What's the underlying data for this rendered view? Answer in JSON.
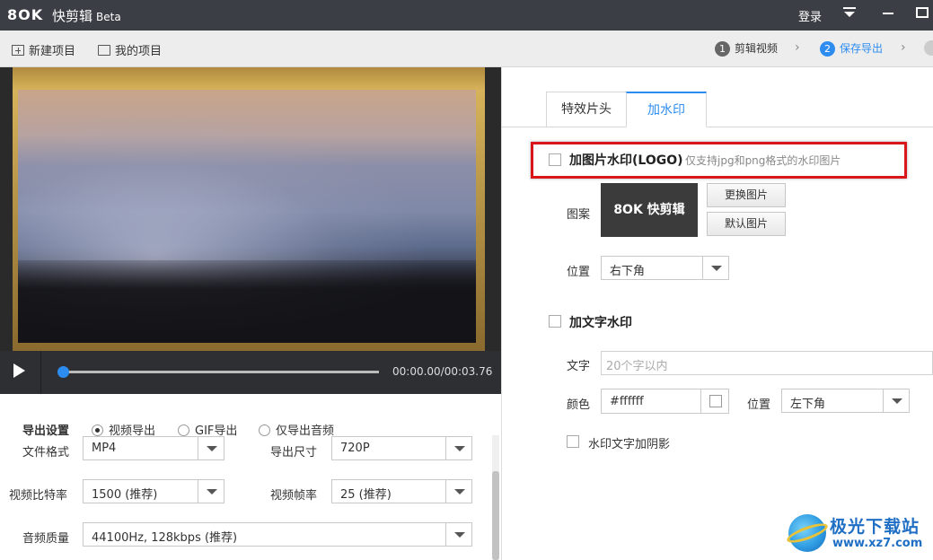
{
  "titlebar": {
    "logo": "8OK",
    "app_name": "快剪辑",
    "version": "Beta",
    "login": "登录"
  },
  "toolbar": {
    "new_project": "新建项目",
    "my_projects": "我的项目",
    "steps": [
      {
        "num": "1",
        "label": "剪辑视频"
      },
      {
        "num": "2",
        "label": "保存导出"
      }
    ]
  },
  "player": {
    "time": "00:00.00/00:03.76",
    "progress": 0.0
  },
  "export": {
    "settings_label": "导出设置",
    "modes": [
      "视频导出",
      "GIF导出",
      "仅导出音频"
    ],
    "selected_mode": "视频导出",
    "file_format": {
      "label": "文件格式",
      "value": "MP4"
    },
    "export_size": {
      "label": "导出尺寸",
      "value": "720P"
    },
    "bitrate": {
      "label": "视频比特率",
      "value": "1500 (推荐)"
    },
    "frame_rate": {
      "label": "视频帧率",
      "value": "25 (推荐)"
    },
    "audio_quality": {
      "label": "音频质量",
      "value": "44100Hz, 128kbps (推荐)"
    }
  },
  "right": {
    "tabs": [
      "特效片头",
      "加水印"
    ],
    "active_tab": "加水印",
    "image_wm": {
      "title": "加图片水印(LOGO)",
      "hint": "仅支持jpg和png格式的水印图片",
      "pattern_label": "图案",
      "logo_text": "8OK 快剪辑",
      "replace_btn": "更换图片",
      "default_btn": "默认图片",
      "position_label": "位置",
      "position_value": "右下角"
    },
    "text_wm": {
      "title": "加文字水印",
      "text_label": "文字",
      "text_placeholder": "20个字以内",
      "color_label": "颜色",
      "color_value": "#ffffff",
      "position_label": "位置",
      "position_value": "左下角",
      "shadow_label": "水印文字加阴影"
    }
  },
  "site_watermark": {
    "name": "极光下载站",
    "url": "www.xz7.com"
  }
}
